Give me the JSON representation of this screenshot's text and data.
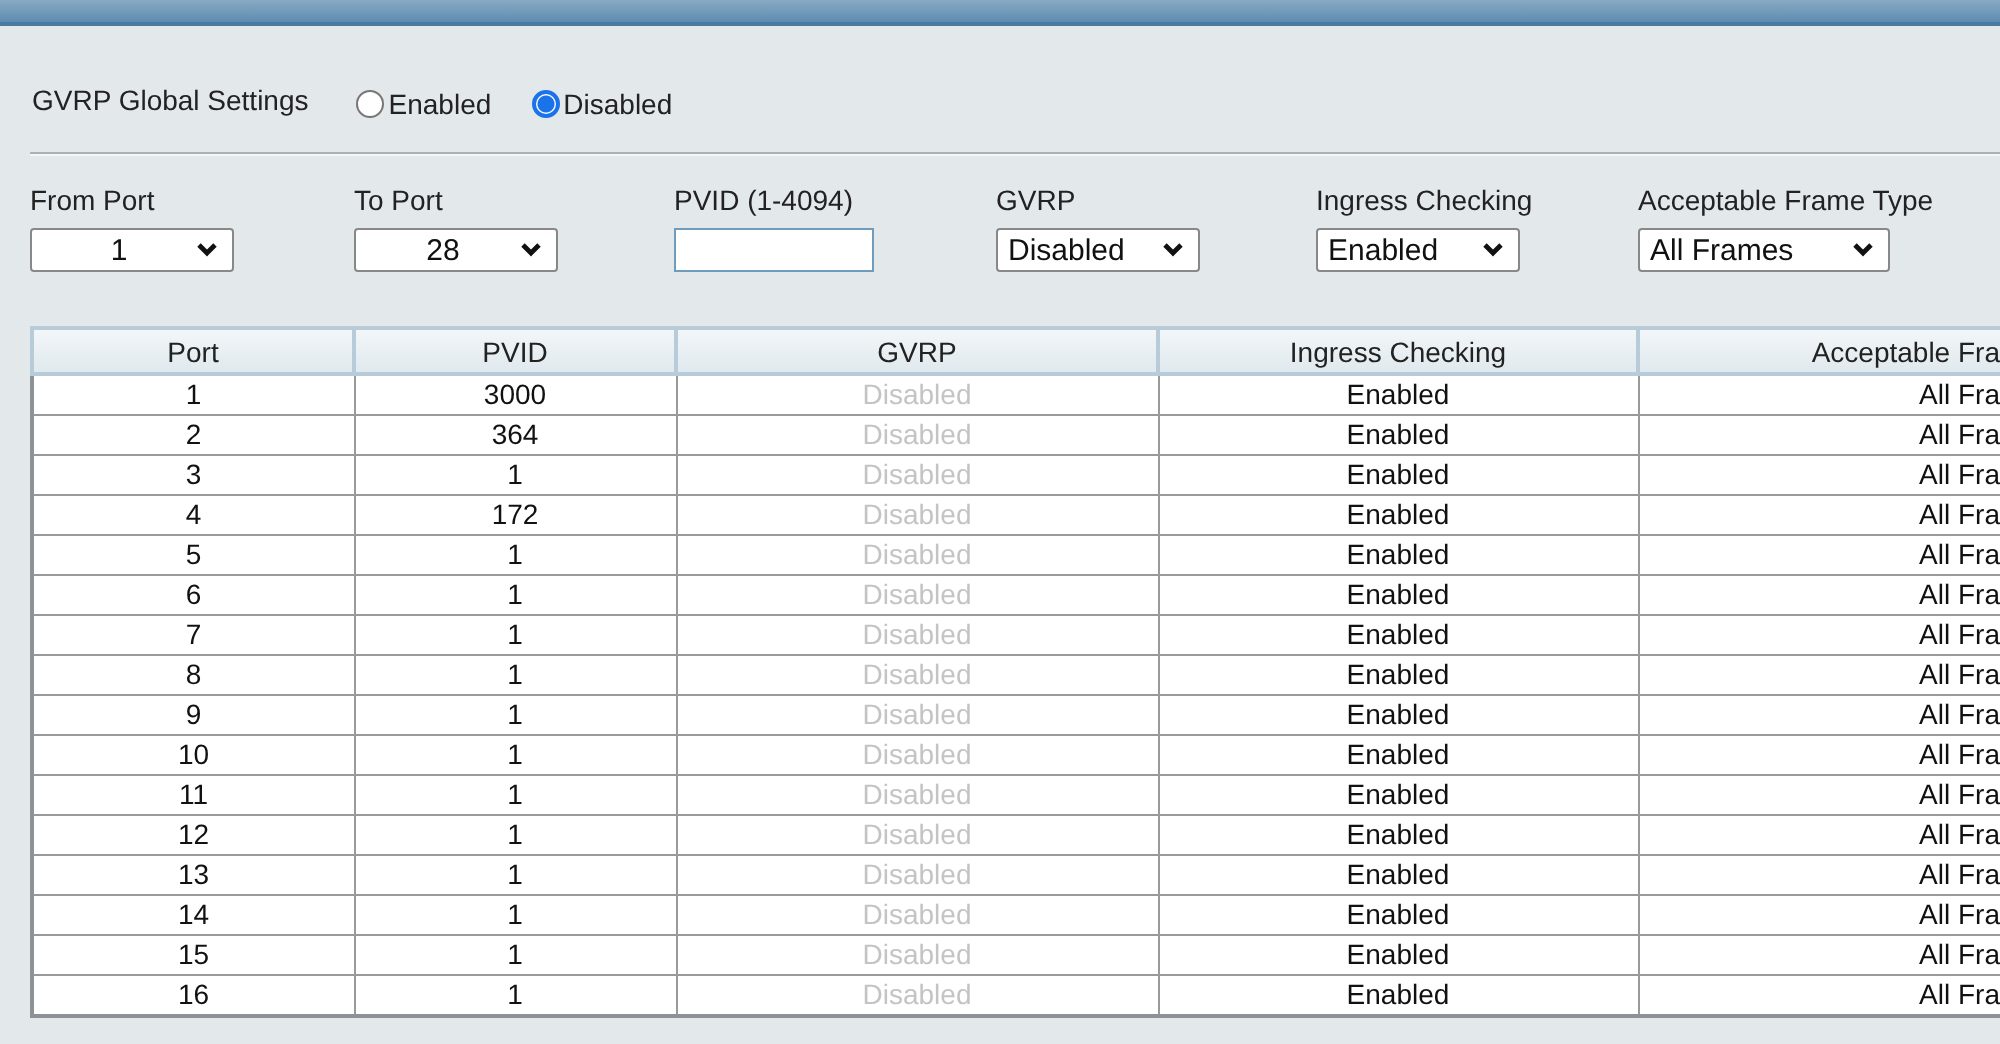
{
  "global": {
    "label": "GVRP Global Settings",
    "options": [
      {
        "label": "Enabled",
        "selected": false
      },
      {
        "label": "Disabled",
        "selected": true
      }
    ]
  },
  "form": [
    {
      "kind": "select",
      "label": "From Port",
      "value": "1"
    },
    {
      "kind": "select",
      "label": "To Port",
      "value": "28"
    },
    {
      "kind": "input",
      "label": "PVID (1-4094)"
    },
    {
      "kind": "select",
      "label": "GVRP",
      "value": "Disabled"
    },
    {
      "kind": "select",
      "label": "Ingress Checking",
      "value": "Enabled"
    },
    {
      "kind": "select",
      "label": "Acceptable Frame Type",
      "value": "All Frames"
    }
  ],
  "table": {
    "columns": [
      "Port",
      "PVID",
      "GVRP",
      "Ingress Checking",
      "Acceptable Fra"
    ],
    "rows": [
      {
        "port": "1",
        "pvid": "3000",
        "gvrp": "Disabled",
        "gvrp_greyed": true,
        "ingress": "Enabled",
        "frame_type": "All Fra"
      },
      {
        "port": "2",
        "pvid": "364",
        "gvrp": "Disabled",
        "gvrp_greyed": true,
        "ingress": "Enabled",
        "frame_type": "All Fra"
      },
      {
        "port": "3",
        "pvid": "1",
        "gvrp": "Disabled",
        "gvrp_greyed": true,
        "ingress": "Enabled",
        "frame_type": "All Fra"
      },
      {
        "port": "4",
        "pvid": "172",
        "gvrp": "Disabled",
        "gvrp_greyed": true,
        "ingress": "Enabled",
        "frame_type": "All Fra"
      },
      {
        "port": "5",
        "pvid": "1",
        "gvrp": "Disabled",
        "gvrp_greyed": true,
        "ingress": "Enabled",
        "frame_type": "All Fra"
      },
      {
        "port": "6",
        "pvid": "1",
        "gvrp": "Disabled",
        "gvrp_greyed": true,
        "ingress": "Enabled",
        "frame_type": "All Fra"
      },
      {
        "port": "7",
        "pvid": "1",
        "gvrp": "Disabled",
        "gvrp_greyed": true,
        "ingress": "Enabled",
        "frame_type": "All Fra"
      },
      {
        "port": "8",
        "pvid": "1",
        "gvrp": "Disabled",
        "gvrp_greyed": true,
        "ingress": "Enabled",
        "frame_type": "All Fra"
      },
      {
        "port": "9",
        "pvid": "1",
        "gvrp": "Disabled",
        "gvrp_greyed": true,
        "ingress": "Enabled",
        "frame_type": "All Fra"
      },
      {
        "port": "10",
        "pvid": "1",
        "gvrp": "Disabled",
        "gvrp_greyed": true,
        "ingress": "Enabled",
        "frame_type": "All Fra"
      },
      {
        "port": "11",
        "pvid": "1",
        "gvrp": "Disabled",
        "gvrp_greyed": true,
        "ingress": "Enabled",
        "frame_type": "All Fra"
      },
      {
        "port": "12",
        "pvid": "1",
        "gvrp": "Disabled",
        "gvrp_greyed": true,
        "ingress": "Enabled",
        "frame_type": "All Fra"
      },
      {
        "port": "13",
        "pvid": "1",
        "gvrp": "Disabled",
        "gvrp_greyed": true,
        "ingress": "Enabled",
        "frame_type": "All Fra"
      },
      {
        "port": "14",
        "pvid": "1",
        "gvrp": "Disabled",
        "gvrp_greyed": true,
        "ingress": "Enabled",
        "frame_type": "All Fra"
      },
      {
        "port": "15",
        "pvid": "1",
        "gvrp": "Disabled",
        "gvrp_greyed": true,
        "ingress": "Enabled",
        "frame_type": "All Fra"
      },
      {
        "port": "16",
        "pvid": "1",
        "gvrp": "Disabled",
        "gvrp_greyed": true,
        "ingress": "Enabled",
        "frame_type": "All Fra"
      }
    ]
  }
}
